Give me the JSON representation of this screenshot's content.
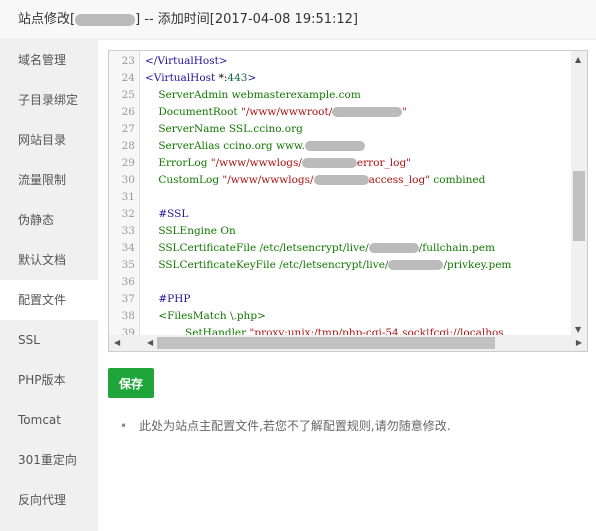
{
  "header": {
    "title_prefix": "站点修改[",
    "title_suffix": "] -- 添加时间[2017-04-08 19:51:12]"
  },
  "sidebar": {
    "items": [
      "域名管理",
      "子目录绑定",
      "网站目录",
      "流量限制",
      "伪静态",
      "默认文档",
      "配置文件",
      "SSL",
      "PHP版本",
      "Tomcat",
      "301重定向",
      "反向代理"
    ],
    "active": "配置文件"
  },
  "editor": {
    "lines": [
      {
        "n": "23",
        "parts": [
          {
            "c": "b",
            "t": "</VirtualHost>"
          }
        ]
      },
      {
        "n": "24",
        "parts": [
          {
            "c": "b",
            "t": "<VirtualHost "
          },
          {
            "c": "k",
            "t": "*:"
          },
          {
            "c": "n",
            "t": "443"
          },
          {
            "c": "b",
            "t": ">"
          }
        ]
      },
      {
        "n": "25",
        "parts": [
          {
            "c": "g",
            "t": "    ServerAdmin webmasterexample.com"
          }
        ]
      },
      {
        "n": "26",
        "parts": [
          {
            "c": "g",
            "t": "    DocumentRoot "
          },
          {
            "c": "r",
            "t": "\"/www/wwwroot/"
          },
          {
            "m": 70
          },
          {
            "c": "r",
            "t": "\""
          }
        ]
      },
      {
        "n": "27",
        "parts": [
          {
            "c": "g",
            "t": "    ServerName SSL.ccino.org"
          }
        ]
      },
      {
        "n": "28",
        "parts": [
          {
            "c": "g",
            "t": "    ServerAlias ccino.org www."
          },
          {
            "m": 60
          }
        ]
      },
      {
        "n": "29",
        "parts": [
          {
            "c": "g",
            "t": "    ErrorLog "
          },
          {
            "c": "r",
            "t": "\"/www/wwwlogs/"
          },
          {
            "m": 55
          },
          {
            "c": "r",
            "t": "error_log\""
          }
        ]
      },
      {
        "n": "30",
        "parts": [
          {
            "c": "g",
            "t": "    CustomLog "
          },
          {
            "c": "r",
            "t": "\"/www/wwwlogs/"
          },
          {
            "m": 55
          },
          {
            "c": "r",
            "t": "access_log\""
          },
          {
            "c": "g",
            "t": " combined"
          }
        ]
      },
      {
        "n": "31",
        "parts": []
      },
      {
        "n": "32",
        "parts": [
          {
            "c": "b",
            "t": "    #SSL"
          }
        ]
      },
      {
        "n": "33",
        "parts": [
          {
            "c": "g",
            "t": "    SSLEngine On"
          }
        ]
      },
      {
        "n": "34",
        "parts": [
          {
            "c": "g",
            "t": "    SSLCertificateFile /etc/letsencrypt/live/"
          },
          {
            "m": 50
          },
          {
            "c": "g",
            "t": "/fullchain.pem"
          }
        ]
      },
      {
        "n": "35",
        "parts": [
          {
            "c": "g",
            "t": "    SSLCertificateKeyFile /etc/letsencrypt/live/"
          },
          {
            "m": 55
          },
          {
            "c": "g",
            "t": "/privkey.pem"
          }
        ]
      },
      {
        "n": "36",
        "parts": []
      },
      {
        "n": "37",
        "parts": [
          {
            "c": "b",
            "t": "    #PHP"
          }
        ]
      },
      {
        "n": "38",
        "parts": [
          {
            "c": "g",
            "t": "    <FilesMatch \\.php>"
          }
        ]
      },
      {
        "n": "39",
        "parts": [
          {
            "c": "g",
            "t": "            SetHandler "
          },
          {
            "c": "r",
            "t": "\"proxy:unix:/tmp/php-cgi-54.sock|fcgi://localhos"
          }
        ]
      }
    ]
  },
  "save_label": "保存",
  "note": "此处为站点主配置文件,若您不了解配置规则,请勿随意修改.",
  "colors": {
    "save": "#20a53a"
  }
}
